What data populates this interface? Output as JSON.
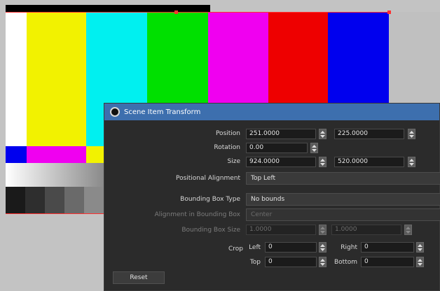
{
  "canvas": {
    "colors": {
      "white": "#ffffff",
      "yellow": "#f2f200",
      "cyan": "#00f0f0",
      "green": "#00e000",
      "magenta": "#f000f0",
      "red": "#ee0000",
      "blue": "#0000ee",
      "black": "#000000",
      "selection_outline": "#ff3030"
    }
  },
  "dialog": {
    "title": "Scene Item Transform",
    "icon": "obs-logo-icon",
    "position_label": "Position",
    "position_x": "251.0000",
    "position_y": "225.0000",
    "rotation_label": "Rotation",
    "rotation_value": "0.00",
    "size_label": "Size",
    "size_width": "924.0000",
    "size_height": "520.0000",
    "positional_alignment_label": "Positional Alignment",
    "positional_alignment_value": "Top Left",
    "bounding_box_type_label": "Bounding Box Type",
    "bounding_box_type_value": "No bounds",
    "alignment_in_bounding_box_label": "Alignment in Bounding Box",
    "alignment_in_bounding_box_value": "Center",
    "bounding_box_size_label": "Bounding Box Size",
    "bounding_box_width": "1.0000",
    "bounding_box_height": "1.0000",
    "crop_label": "Crop",
    "crop_left_label": "Left",
    "crop_left_value": "0",
    "crop_right_label": "Right",
    "crop_right_value": "0",
    "crop_top_label": "Top",
    "crop_top_value": "0",
    "crop_bottom_label": "Bottom",
    "crop_bottom_value": "0",
    "reset_label": "Reset"
  }
}
